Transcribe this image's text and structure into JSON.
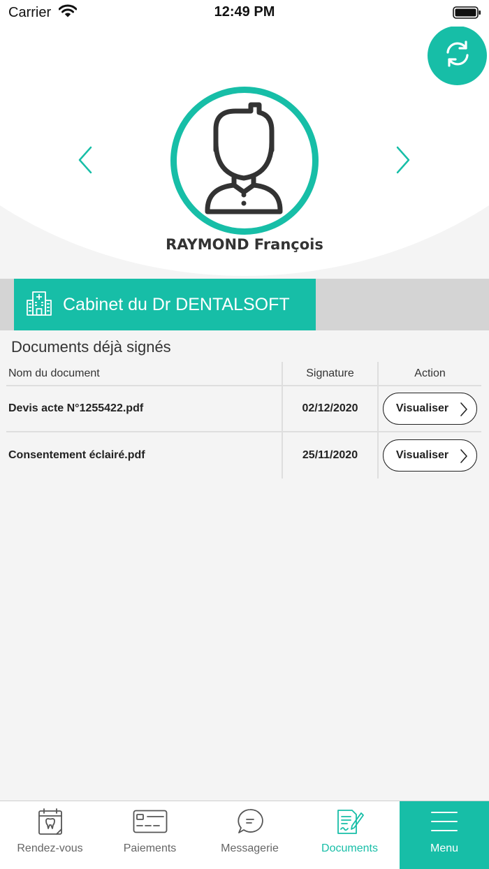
{
  "status_bar": {
    "carrier": "Carrier",
    "time": "12:49 PM"
  },
  "patient": {
    "name": "RAYMOND François"
  },
  "cabinet": {
    "name": "Cabinet du Dr DENTALSOFT"
  },
  "documents": {
    "section_title": "Documents déjà signés",
    "columns": [
      "Nom du document",
      "Signature",
      "Action"
    ],
    "rows": [
      {
        "name": "Devis acte N°1255422.pdf",
        "date": "02/12/2020",
        "action": "Visualiser"
      },
      {
        "name": "Consentement éclairé.pdf",
        "date": "25/11/2020",
        "action": "Visualiser"
      }
    ]
  },
  "tabbar": {
    "active": "Documents",
    "items": [
      {
        "label": "Rendez-vous",
        "icon": "calendar-tooth-icon"
      },
      {
        "label": "Paiements",
        "icon": "credit-card-icon"
      },
      {
        "label": "Messagerie",
        "icon": "chat-bubble-icon"
      },
      {
        "label": "Documents",
        "icon": "document-sign-icon"
      },
      {
        "label": "Menu",
        "icon": "hamburger-menu-icon"
      }
    ]
  },
  "colors": {
    "accent": "#17bea7",
    "background": "#f4f4f4",
    "band": "#d4d4d4"
  }
}
